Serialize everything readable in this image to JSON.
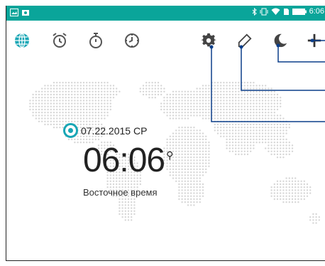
{
  "statusbar": {
    "time": "6:06",
    "left_icons": [
      "image-icon",
      "photo-icon"
    ],
    "right_icons": [
      "bluetooth-icon",
      "vibrate-icon",
      "wifi-icon",
      "sim-icon",
      "battery-icon"
    ]
  },
  "toolbar": {
    "left_tabs": [
      "world-clock-icon",
      "alarm-icon",
      "stopwatch-icon",
      "timer-icon"
    ],
    "right_buttons": [
      "settings-icon",
      "edit-icon",
      "night-mode-icon",
      "add-icon"
    ]
  },
  "clock": {
    "date": "07.22.2015 СР",
    "time": "06:06",
    "timezone": "Восточное время"
  },
  "colors": {
    "accent": "#0aa59a",
    "marker": "#18a6b5",
    "callout": "#0b3e8a"
  }
}
